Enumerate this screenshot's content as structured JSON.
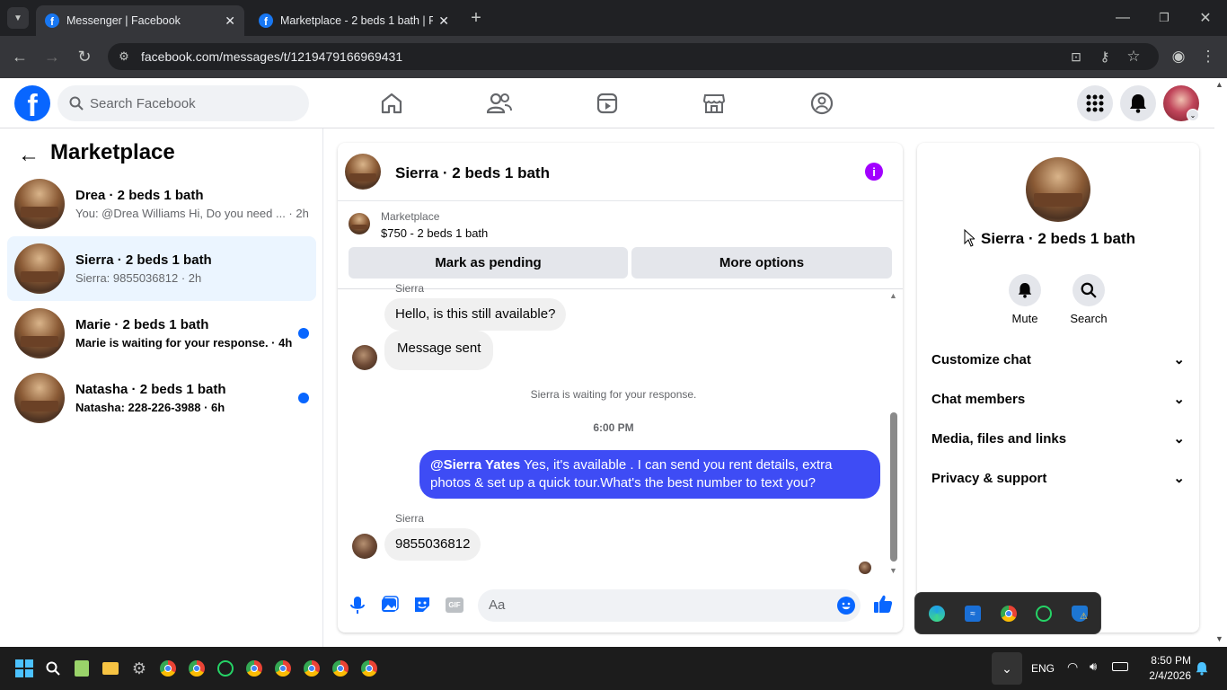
{
  "browser": {
    "tabs": [
      {
        "title": "Messenger | Facebook"
      },
      {
        "title": "Marketplace - 2 beds 1 bath | Fa"
      }
    ],
    "url": "facebook.com/messages/t/1219479166969431"
  },
  "fb": {
    "search_placeholder": "Search Facebook"
  },
  "sidebar": {
    "title": "Marketplace",
    "conversations": [
      {
        "name": "Drea · 2 beds 1 bath",
        "preview": "You: @Drea Williams Hi, Do you need ... · 2h"
      },
      {
        "name": "Sierra · 2 beds 1 bath",
        "preview": "Sierra: 9855036812 · 2h"
      },
      {
        "name": "Marie · 2 beds 1 bath",
        "preview": "Marie is waiting for your response. · 4h"
      },
      {
        "name": "Natasha · 2 beds 1 bath",
        "preview": "Natasha: 228-226-3988 · 6h"
      }
    ]
  },
  "chat": {
    "title": "Sierra · 2 beds 1 bath",
    "listing_source": "Marketplace",
    "listing_title": "$750 - 2 beds 1 bath",
    "mark_pending": "Mark as pending",
    "more_options": "More options",
    "sender_top": "Sierra",
    "msg1": "Hello, is this still available?",
    "msg2": "Message sent",
    "waiting": "Sierra is waiting for your response.",
    "time": "6:00 PM",
    "mention": "@Sierra Yates",
    "outgoing": " Yes, it's available .  I can send you rent details, extra photos & set up a quick tour.What's the best number to text you?",
    "sender2": "Sierra",
    "msg3": "9855036812",
    "composer_placeholder": "Aa"
  },
  "info_panel": {
    "name": "Sierra · 2 beds 1 bath",
    "mute": "Mute",
    "search": "Search",
    "sections": [
      "Customize chat",
      "Chat members",
      "Media, files and links",
      "Privacy & support"
    ]
  },
  "taskbar": {
    "lang": "ENG",
    "time": "8:50 PM",
    "date": "2/4/2026"
  },
  "colors": {
    "fb_blue": "#0866ff",
    "outgoing_bubble": "#3e4cf5",
    "info_purple": "#a200ff"
  }
}
